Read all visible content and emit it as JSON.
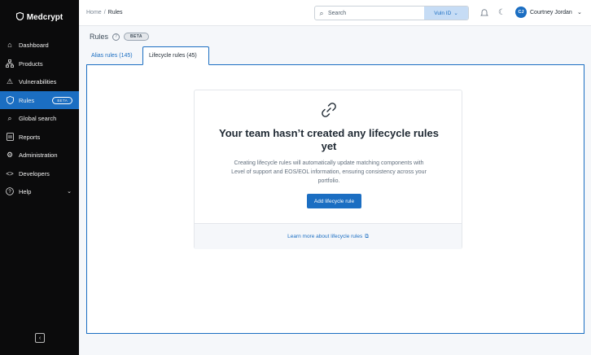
{
  "app": {
    "name": "Medcrypt",
    "logo_icon": "shield-icon"
  },
  "sidebar": {
    "items": [
      {
        "label": "Dashboard",
        "icon": "home-icon"
      },
      {
        "label": "Products",
        "icon": "hierarchy-icon"
      },
      {
        "label": "Vulnerabilities",
        "icon": "warning-icon"
      },
      {
        "label": "Rules",
        "icon": "shield-check-icon",
        "badge": "BETA",
        "active": true
      },
      {
        "label": "Global search",
        "icon": "search-icon"
      },
      {
        "label": "Reports",
        "icon": "report-icon"
      },
      {
        "label": "Administration",
        "icon": "gear-icon"
      },
      {
        "label": "Developers",
        "icon": "code-icon"
      },
      {
        "label": "Help",
        "icon": "help-icon"
      }
    ],
    "collapse_icon": "chevron-left-icon"
  },
  "header": {
    "breadcrumb": [
      "Home",
      "Rules"
    ],
    "search": {
      "placeholder": "Search",
      "scope": "Vuln ID"
    },
    "user": {
      "initials": "CJ",
      "name": "Courtney Jordan"
    }
  },
  "page": {
    "title": "Rules",
    "beta": "BETA",
    "tabs": [
      {
        "label": "Alias rules (145)"
      },
      {
        "label": "Lifecycle rules (45)",
        "active": true
      }
    ]
  },
  "empty_state": {
    "icon": "link-icon",
    "title": "Your team hasn’t created any lifecycle rules yet",
    "description": "Creating lifecycle rules will automatically update matching components with Level of support and EOS/EOL information, ensuring consistency across your portfolio.",
    "button": "Add lifecycle rule",
    "learn_more": "Learn more about lifecycle rules"
  },
  "colors": {
    "accent": "#1b6ec2",
    "sidebar_bg": "#0b0b0c"
  }
}
